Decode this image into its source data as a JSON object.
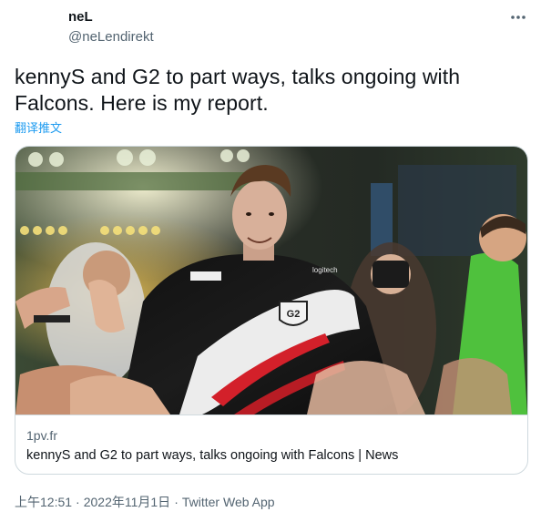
{
  "author": {
    "display_name": "neL",
    "handle": "@neLendirekt",
    "more_icon": "ellipsis-icon"
  },
  "tweet": {
    "text": "kennyS and G2 to part ways, talks ongoing with Falcons. Here is my report.",
    "translate_label": "翻译推文"
  },
  "card": {
    "domain": "1pv.fr",
    "title": "kennyS and G2 to part ways, talks ongoing with Falcons | News",
    "image_brand_text": [
      "logitech",
      "G2"
    ]
  },
  "footer": {
    "time": "上午12:51",
    "separator": "·",
    "date": "2022年11月1日",
    "source": "Twitter Web App"
  },
  "colors": {
    "text_primary": "#0f1419",
    "text_secondary": "#536471",
    "link": "#1d9bf0",
    "border": "#cfd9de"
  }
}
